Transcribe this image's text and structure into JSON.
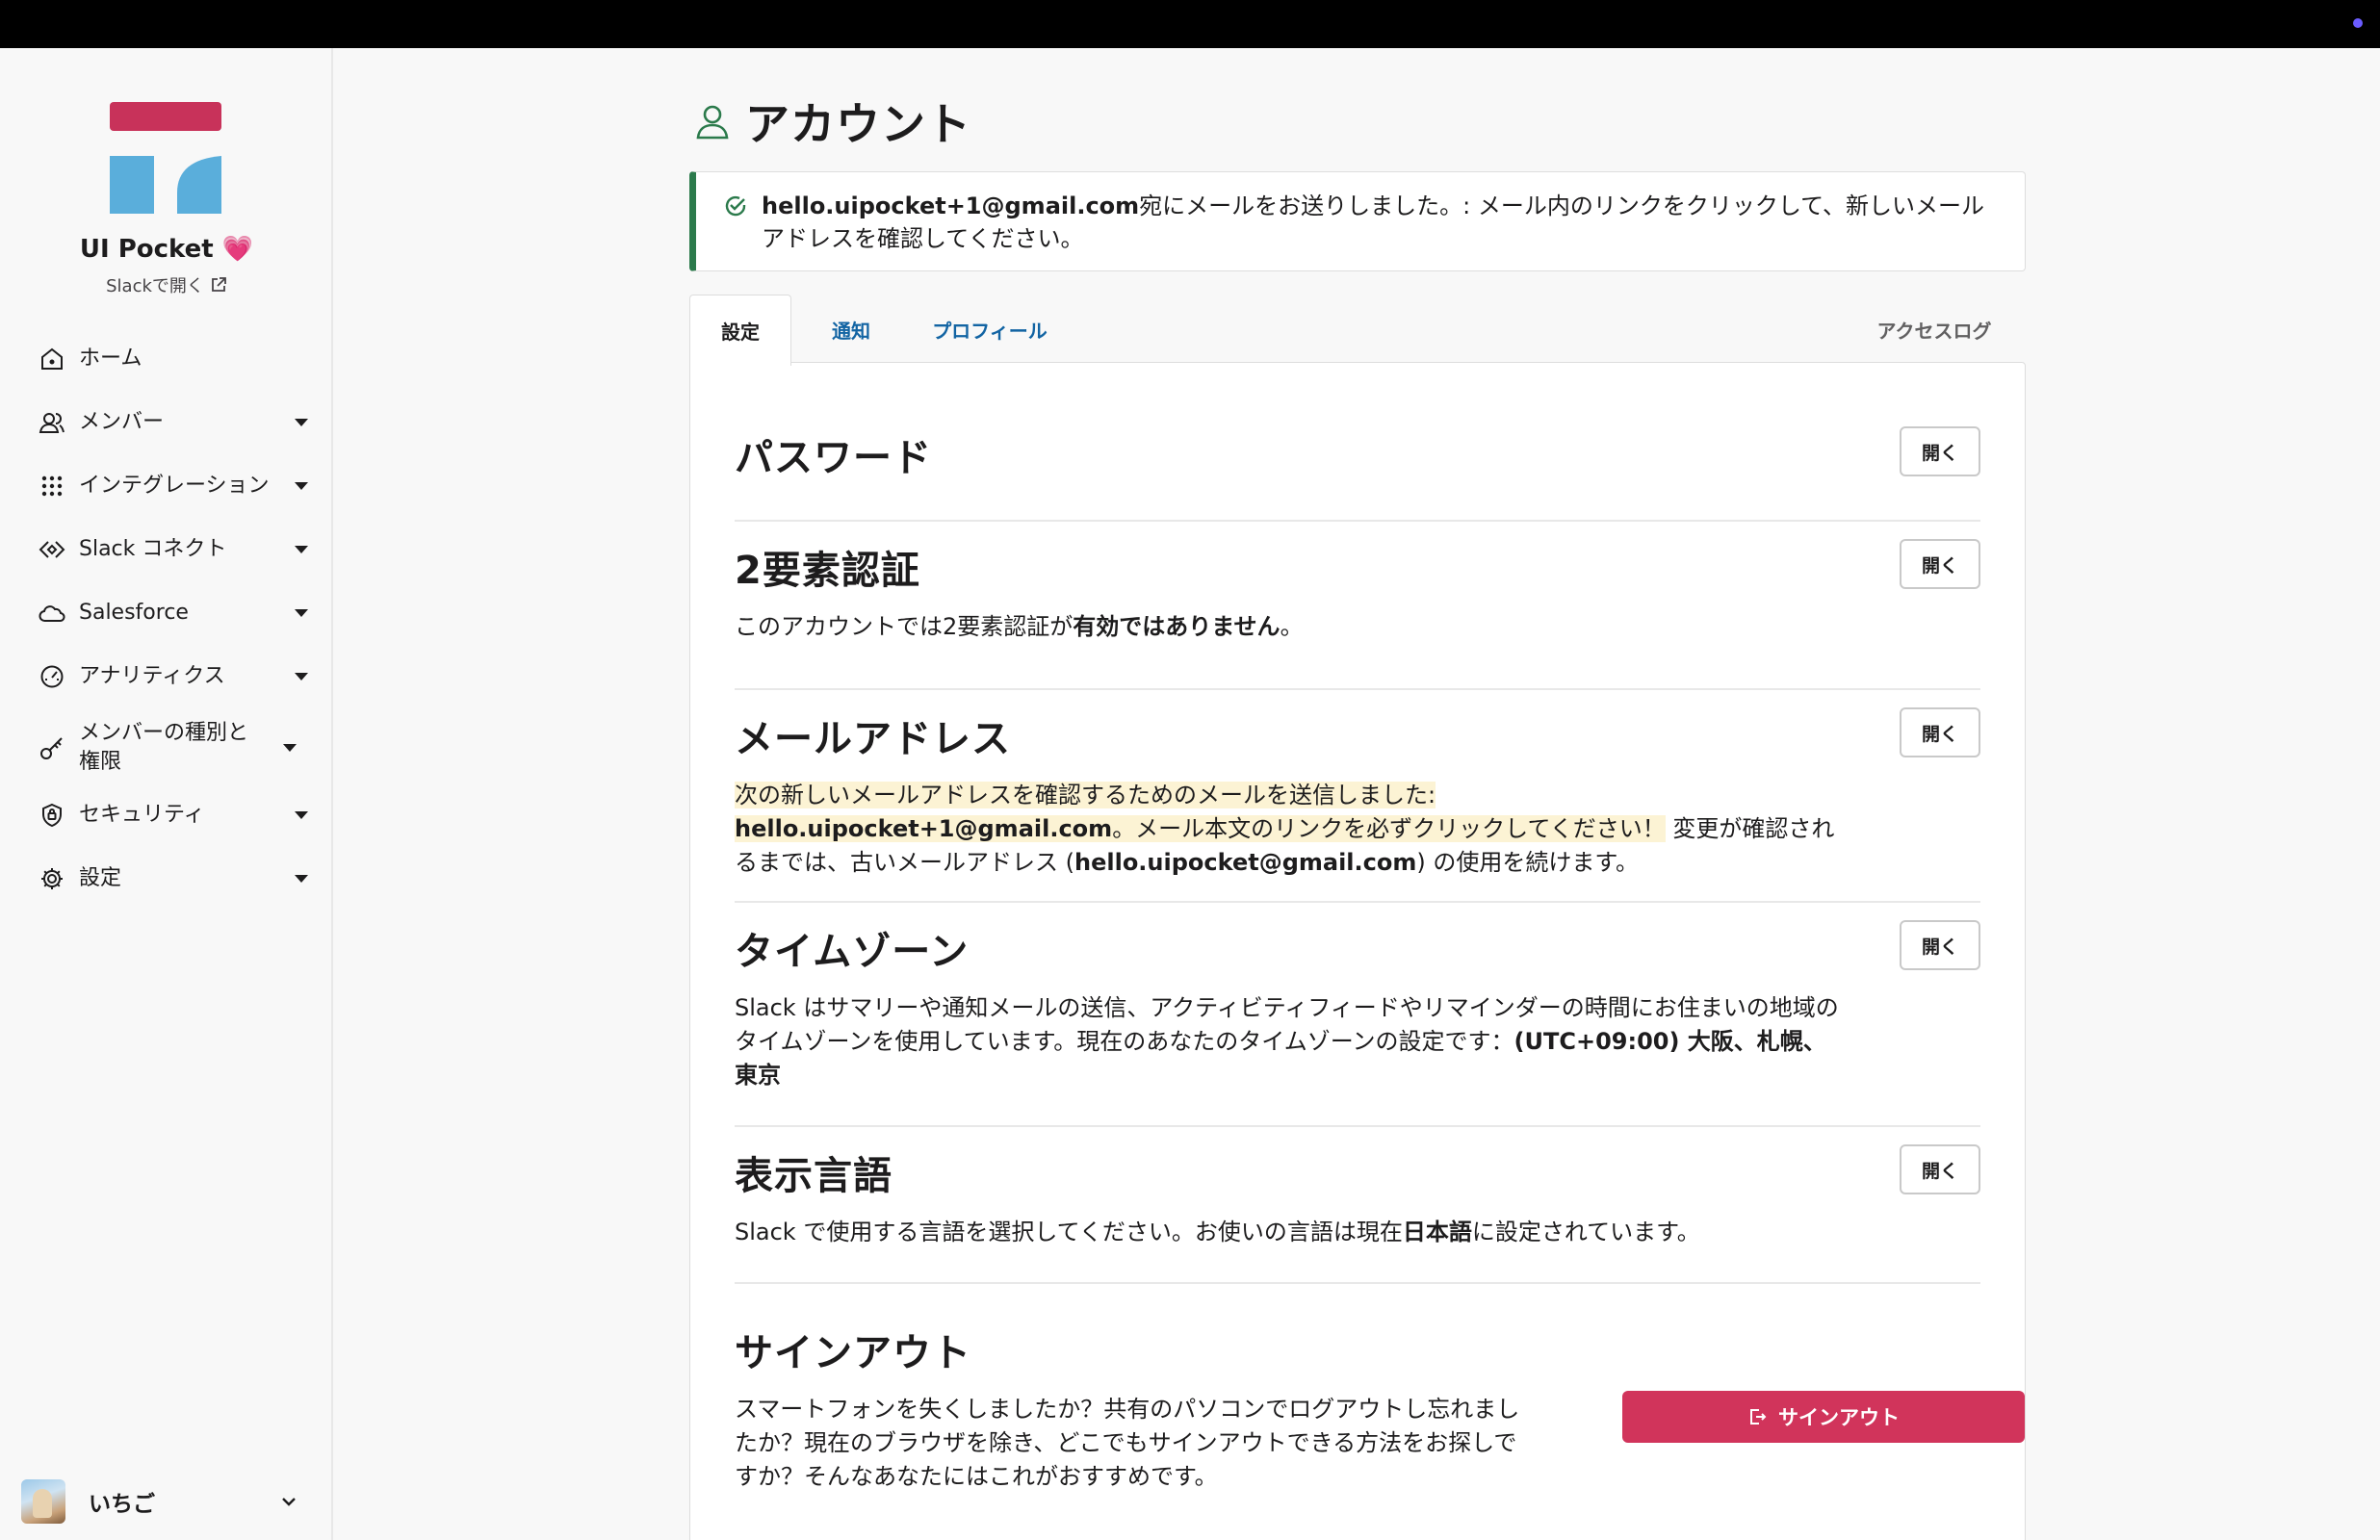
{
  "workspace": {
    "name": "UI Pocket",
    "heart": "💗",
    "open_in_slack": "Slackで開く",
    "logo_colors": {
      "bar": "#c8325a",
      "blocks": "#5aaedb"
    }
  },
  "sidebar": {
    "items": [
      {
        "label": "ホーム",
        "icon": "home-icon",
        "has_caret": false
      },
      {
        "label": "メンバー",
        "icon": "members-icon",
        "has_caret": true
      },
      {
        "label": "インテグレーション",
        "icon": "grid-icon",
        "has_caret": true
      },
      {
        "label": "Slack コネクト",
        "icon": "connect-icon",
        "has_caret": true
      },
      {
        "label": "Salesforce",
        "icon": "cloud-icon",
        "has_caret": true
      },
      {
        "label": "アナリティクス",
        "icon": "gauge-icon",
        "has_caret": true
      },
      {
        "label": "メンバーの種別と権限",
        "icon": "key-icon",
        "has_caret": true
      },
      {
        "label": "セキュリティ",
        "icon": "shield-icon",
        "has_caret": true
      },
      {
        "label": "設定",
        "icon": "gear-icon",
        "has_caret": true
      }
    ],
    "user": {
      "name": "いちご"
    }
  },
  "page": {
    "title": "アカウント"
  },
  "alert": {
    "email": "hello.uipocket+1@gmail.com",
    "message": "宛にメールをお送りしました。: メール内のリンクをクリックして、新しいメールアドレスを確認してください。"
  },
  "tabs": {
    "settings": "設定",
    "notifications": "通知",
    "profile": "プロフィール",
    "access_log": "アクセスログ"
  },
  "sections": {
    "open_label": "開く",
    "password": {
      "title": "パスワード"
    },
    "two_factor": {
      "title": "2要素認証",
      "desc_prefix": "このアカウントでは2要素認証が",
      "desc_bold": "有効ではありません",
      "desc_suffix": "。"
    },
    "email": {
      "title": "メールアドレス",
      "hl_prefix": "次の新しいメールアドレスを確認するためのメールを送信しました: ",
      "new_email": "hello.uipocket+1@gmail.com",
      "hl_suffix": "。メール本文のリンクを必ずクリックしてください！",
      "rest_prefix": " 変更が確認されるまでは、古いメールアドレス (",
      "old_email": "hello.uipocket@gmail.com",
      "rest_suffix": ") の使用を続けます。"
    },
    "timezone": {
      "title": "タイムゾーン",
      "desc_prefix": "Slack はサマリーや通知メールの送信、アクティビティフィードやリマインダーの時間にお住まいの地域のタイムゾーンを使用しています。現在のあなたのタイムゾーンの設定です：",
      "desc_bold": "(UTC+09:00) 大阪、札幌、東京"
    },
    "language": {
      "title": "表示言語",
      "desc_prefix": "Slack で使用する言語を選択してください。お使いの言語は現在",
      "desc_bold": "日本語",
      "desc_suffix": "に設定されています。"
    },
    "signout": {
      "title": "サインアウト",
      "desc": "スマートフォンを失くしましたか？共有のパソコンでログアウトし忘れましたか？現在のブラウザを除き、どこでもサインアウトできる方法をお探しですか？そんなあなたにはこれがおすすめです。",
      "button": "サインアウト"
    }
  }
}
